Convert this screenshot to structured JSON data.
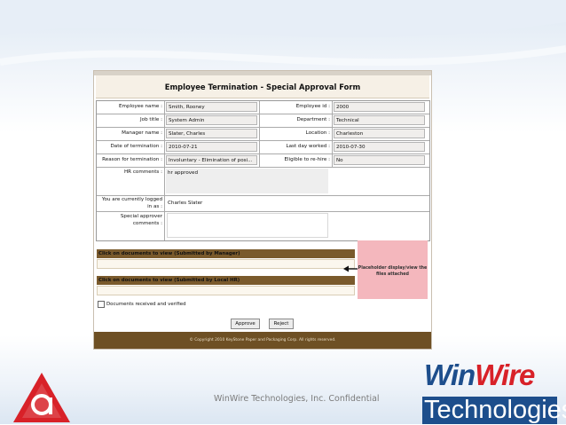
{
  "form": {
    "title": "Employee Termination - Special Approval Form",
    "rows": [
      {
        "label1": "Employee name :",
        "value1": "Smith, Rooney",
        "label2": "Employee id :",
        "value2": "2000"
      },
      {
        "label1": "Job title :",
        "value1": "System Admin",
        "label2": "Department :",
        "value2": "Technical"
      },
      {
        "label1": "Manager name :",
        "value1": "Slater, Charles",
        "label2": "Location :",
        "value2": "Charleston"
      },
      {
        "label1": "Date of termination :",
        "value1": "2010-07-21",
        "label2": "Last day worked :",
        "value2": "2010-07-30"
      },
      {
        "label1": "Reason for termination :",
        "value1": "Involuntary - Elimination of posi...",
        "label2": "Eligible to re-hire :",
        "value2": "No"
      }
    ],
    "hr_comments_label": "HR comments :",
    "hr_comments_value": "hr approved",
    "logged_in_label_1": "You are currently logged",
    "logged_in_label_2": "in as :",
    "logged_in_value": "Charles Slater",
    "approver_label_1": "Special approver",
    "approver_label_2": "comments :",
    "docs_manager": "Click on documents to view (Submitted by Manager)",
    "docs_hr": "Click on documents to view (Submitted by Local HR)",
    "placeholder_1": "Placeholder display/view the",
    "placeholder_2": "files attached",
    "checkbox_label": "Documents received and verified",
    "approve_label": "Approve",
    "reject_label": "Reject",
    "footer_text": "© Copyright 2010 KeyStone Paper and Packaging Corp. All rights reserved."
  },
  "slide": {
    "confidential": "WinWire Technologies, Inc. Confidential",
    "logo_win": "Win",
    "logo_wire": "Wire",
    "logo_tech": "Technologies"
  },
  "colors": {
    "brown_bar": "#7a5a2c",
    "footer_bar": "#6e5024",
    "pink_panel": "#f4b7bd",
    "winwire_blue": "#1d4e8c",
    "winwire_red": "#d82128",
    "appian_red": "#d82128"
  }
}
